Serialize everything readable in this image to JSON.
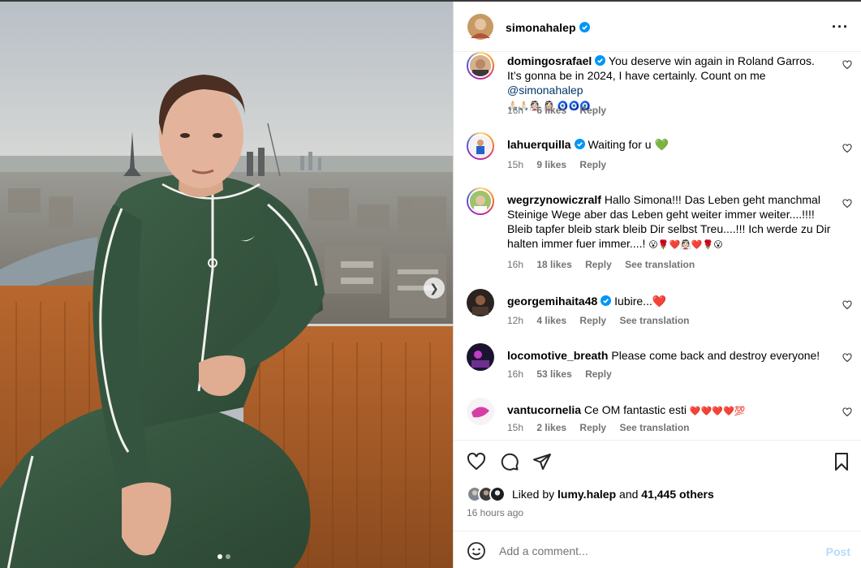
{
  "post": {
    "author": "simonahalep",
    "verified_color": "#0095f6",
    "more_icon": "more-horizontal-icon",
    "image_dots": 2,
    "image_active_index": 0
  },
  "comments": [
    {
      "user": "domingosrafael",
      "verified": true,
      "text": "You deserve win again in Roland Garros. It’s gonna be in 2024, I have certainly. Count on me",
      "mention": "@simonahalep",
      "emojis": "🙏🏻🙏🏻👰🏻 👰🏻 🧿🧿🧿",
      "time": "16h",
      "likes": "6 likes",
      "reply": "Reply",
      "translate": ""
    },
    {
      "user": "lahuerquilla",
      "verified": true,
      "text": "Waiting for u",
      "emojis": "💚",
      "time": "15h",
      "likes": "9 likes",
      "reply": "Reply",
      "translate": ""
    },
    {
      "user": "wegrzynowiczralf",
      "verified": false,
      "text": "Hallo Simona!!! Das Leben geht manchmal Steinige Wege aber das Leben geht weiter immer weiter....!!!! Bleib tapfer bleib stark bleib Dir selbst Treu....!!! Ich werde zu Dir halten immer fuer immer....!",
      "emojis": "😮🌹❤️👰🏻❤️🌹😮",
      "time": "16h",
      "likes": "18 likes",
      "reply": "Reply",
      "translate": "See translation"
    },
    {
      "user": "georgemihaita48",
      "verified": true,
      "text": "Iubire...",
      "emojis": "❤️",
      "time": "12h",
      "likes": "4 likes",
      "reply": "Reply",
      "translate": "See translation"
    },
    {
      "user": "locomotive_breath",
      "verified": false,
      "text": "Please come back and destroy everyone!",
      "emojis": "",
      "time": "16h",
      "likes": "53 likes",
      "reply": "Reply",
      "translate": ""
    },
    {
      "user": "vantucornelia",
      "verified": false,
      "text": "Ce OM fantastic esti",
      "emojis": "❤️❤️❤️❤️💯",
      "time": "15h",
      "likes": "2 likes",
      "reply": "Reply",
      "translate": "See translation"
    }
  ],
  "actions": {
    "like_icon": "heart-icon",
    "comment_icon": "comment-icon",
    "share_icon": "share-icon",
    "save_icon": "bookmark-icon"
  },
  "likes": {
    "prefix": "Liked by",
    "user": "lumy.halep",
    "middle": "and",
    "others": "41,445 others"
  },
  "time_ago": "16 hours ago",
  "add_comment": {
    "placeholder": "Add a comment...",
    "post_label": "Post",
    "post_color": "#b3dbff"
  }
}
